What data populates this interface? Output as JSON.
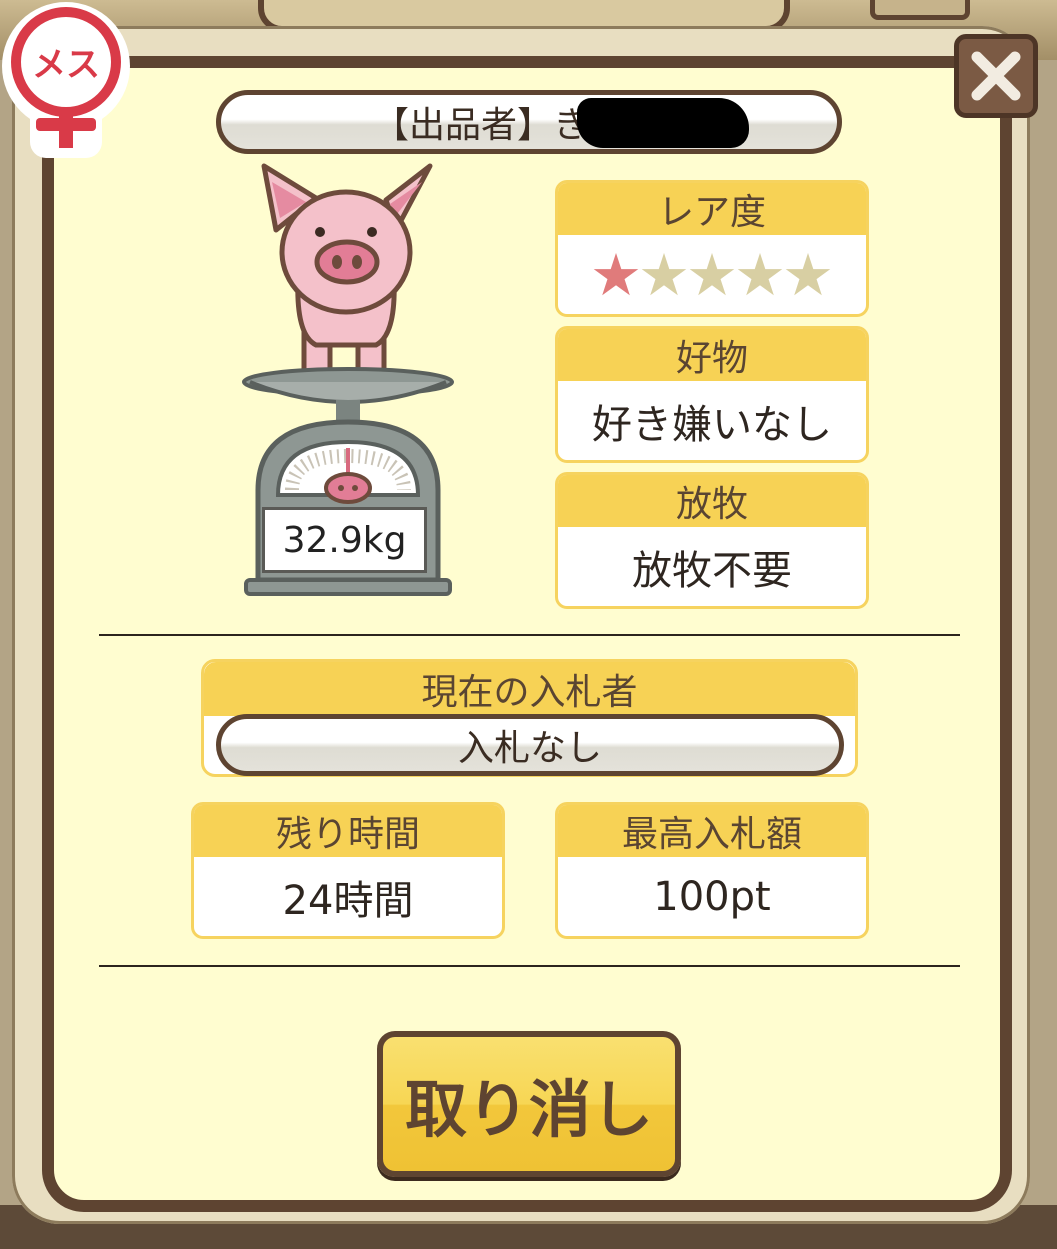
{
  "seller": {
    "label": "【出品者】き"
  },
  "gender": {
    "label": "メス"
  },
  "pig": {
    "weight": "32.9kg"
  },
  "rarity": {
    "title": "レア度",
    "stars_filled": 1,
    "stars_total": 5,
    "filled_color": "#e07b7b",
    "empty_color": "#d8cfa3"
  },
  "favorite": {
    "title": "好物",
    "value": "好き嫌いなし"
  },
  "grazing": {
    "title": "放牧",
    "value": "放牧不要"
  },
  "bidder": {
    "title": "現在の入札者",
    "value": "入札なし"
  },
  "remaining": {
    "title": "残り時間",
    "value": "24時間"
  },
  "highest_bid": {
    "title": "最高入札額",
    "value": "100pt"
  },
  "cancel_button": {
    "label": "取り消し"
  },
  "colors": {
    "frame": "#5e4431",
    "panel": "#fffdd0",
    "header_yellow": "#f7d255",
    "gender_red": "#d93a48"
  }
}
